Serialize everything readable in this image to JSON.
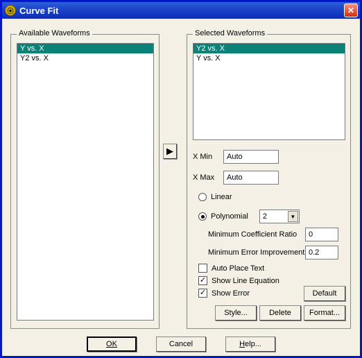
{
  "title": "Curve Fit",
  "available": {
    "label": "Available Waveforms",
    "items": [
      "Y vs. X",
      "Y2 vs. X"
    ],
    "selected_index": 0
  },
  "selected": {
    "label": "Selected Waveforms",
    "items": [
      "Y2 vs. X",
      "Y vs. X"
    ],
    "selected_index": 0
  },
  "xmin": {
    "label": "X Min",
    "value": "Auto"
  },
  "xmax": {
    "label": "X Max",
    "value": "Auto"
  },
  "fit_type": {
    "linear": "Linear",
    "polynomial": "Polynomial",
    "selected": "polynomial",
    "poly_order": "2"
  },
  "min_coef": {
    "label": "Minimum Coefficient Ratio",
    "value": "0"
  },
  "min_err": {
    "label": "Minimum Error Improvement",
    "value": "0.2"
  },
  "checks": {
    "auto_place": {
      "label": "Auto Place Text",
      "checked": false
    },
    "show_eq": {
      "label": "Show Line Equation",
      "checked": true
    },
    "show_err": {
      "label": "Show Error",
      "checked": true
    }
  },
  "buttons": {
    "default": "Default",
    "style": "Style...",
    "delete": "Delete",
    "format": "Format...",
    "ok": "OK",
    "cancel": "Cancel",
    "help": "Help..."
  }
}
